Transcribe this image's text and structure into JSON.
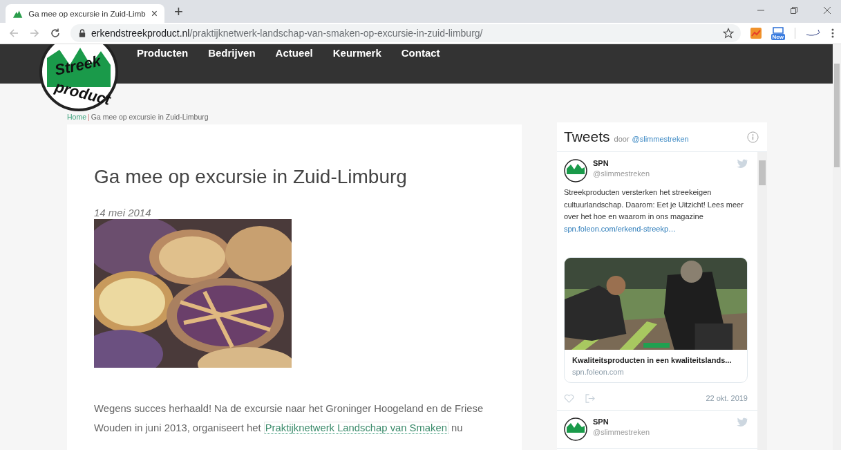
{
  "browser": {
    "tab": {
      "title": "Ga mee op excursie in Zuid-Limb",
      "close": "×",
      "selected": true
    },
    "new_tab": "+",
    "url": {
      "domain": "erkendstreekproduct.nl",
      "path": "/praktijknetwerk-landschap-van-smaken-op-excursie-in-zuid-limburg/"
    },
    "extension_badge": "New"
  },
  "site": {
    "logo": {
      "words": [
        "Streek",
        "product"
      ]
    },
    "nav": [
      "Producten",
      "Bedrijven",
      "Actueel",
      "Keurmerk",
      "Contact"
    ]
  },
  "breadcrumb": {
    "home": "Home",
    "separator": "|",
    "current": "Ga mee op excursie in Zuid-Limburg"
  },
  "article": {
    "title": "Ga mee op excursie in Zuid-Limburg",
    "date": "14 mei 2014",
    "paragraph": [
      {
        "kind": "text",
        "text": "Wegens succes herhaald! Na de excursie naar het Groninger Hoogeland en de Friese Wouden in juni 2013, organiseert het "
      },
      {
        "kind": "link",
        "text": "Praktijknetwerk Landschap van Smaken"
      },
      {
        "kind": "text",
        "text": " nu"
      }
    ]
  },
  "twitter": {
    "title": "Tweets",
    "by": "door",
    "handle": "@slimmestreken",
    "tweets": [
      {
        "name": "SPN",
        "handle": "@slimmestreken",
        "text": "Streekproducten versterken het streekeigen cultuurlandschap. Daarom: Eet je Uitzicht! Lees meer over het hoe en waarom in ons magazine",
        "link": "spn.foleon.com/erkend-streekp…",
        "card": {
          "title": "Kwaliteitsproducten in een kwaliteitslands...",
          "domain": "spn.foleon.com"
        },
        "date": "22 okt. 2019"
      },
      {
        "name": "SPN",
        "handle": "@slimmestreken"
      }
    ]
  }
}
